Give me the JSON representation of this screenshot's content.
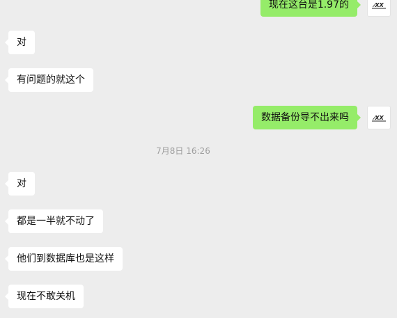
{
  "colors": {
    "background": "#ededed",
    "incoming_bubble": "#ffffff",
    "outgoing_bubble": "#95ec69",
    "timestamp_text": "#9e9e9e"
  },
  "messages": [
    {
      "side": "right",
      "text": "现在这台是1.97的",
      "avatar": "logo-avatar"
    },
    {
      "side": "left",
      "text": "对"
    },
    {
      "side": "left",
      "text": "有问题的就这个"
    },
    {
      "side": "right",
      "text": "数据备份导不出来吗",
      "avatar": "logo-avatar"
    }
  ],
  "timestamp": "7月8日 16:26",
  "messages_after": [
    {
      "side": "left",
      "text": "对"
    },
    {
      "side": "left",
      "text": "都是一半就不动了"
    },
    {
      "side": "left",
      "text": "他们到数据库也是这样"
    },
    {
      "side": "left",
      "text": "现在不敢关机"
    }
  ]
}
